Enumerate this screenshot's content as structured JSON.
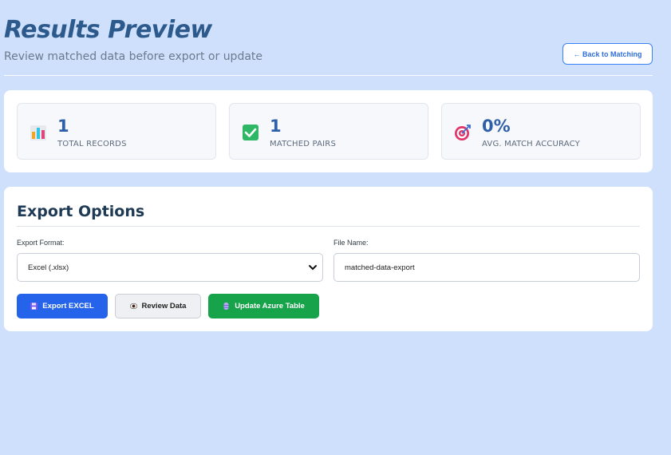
{
  "header": {
    "title": "Results Preview",
    "subtitle": "Review matched data before export or update",
    "back_label": "← Back to Matching"
  },
  "stats": [
    {
      "icon": "bar-chart-icon",
      "value": "1",
      "label": "TOTAL RECORDS"
    },
    {
      "icon": "check-box-icon",
      "value": "1",
      "label": "MATCHED PAIRS"
    },
    {
      "icon": "target-icon",
      "value": "0%",
      "label": "AVG. MATCH ACCURACY"
    }
  ],
  "export": {
    "title": "Export Options",
    "format_label": "Export Format:",
    "format_value": "Excel (.xlsx)",
    "filename_label": "File Name:",
    "filename_value": "matched-data-export",
    "buttons": {
      "export": "Export EXCEL",
      "review": "Review Data",
      "azure": "Update Azure Table"
    }
  },
  "colors": {
    "background": "#cfe0fd",
    "primary": "#2563eb",
    "success": "#16a34a",
    "title": "#2d5a8c"
  }
}
